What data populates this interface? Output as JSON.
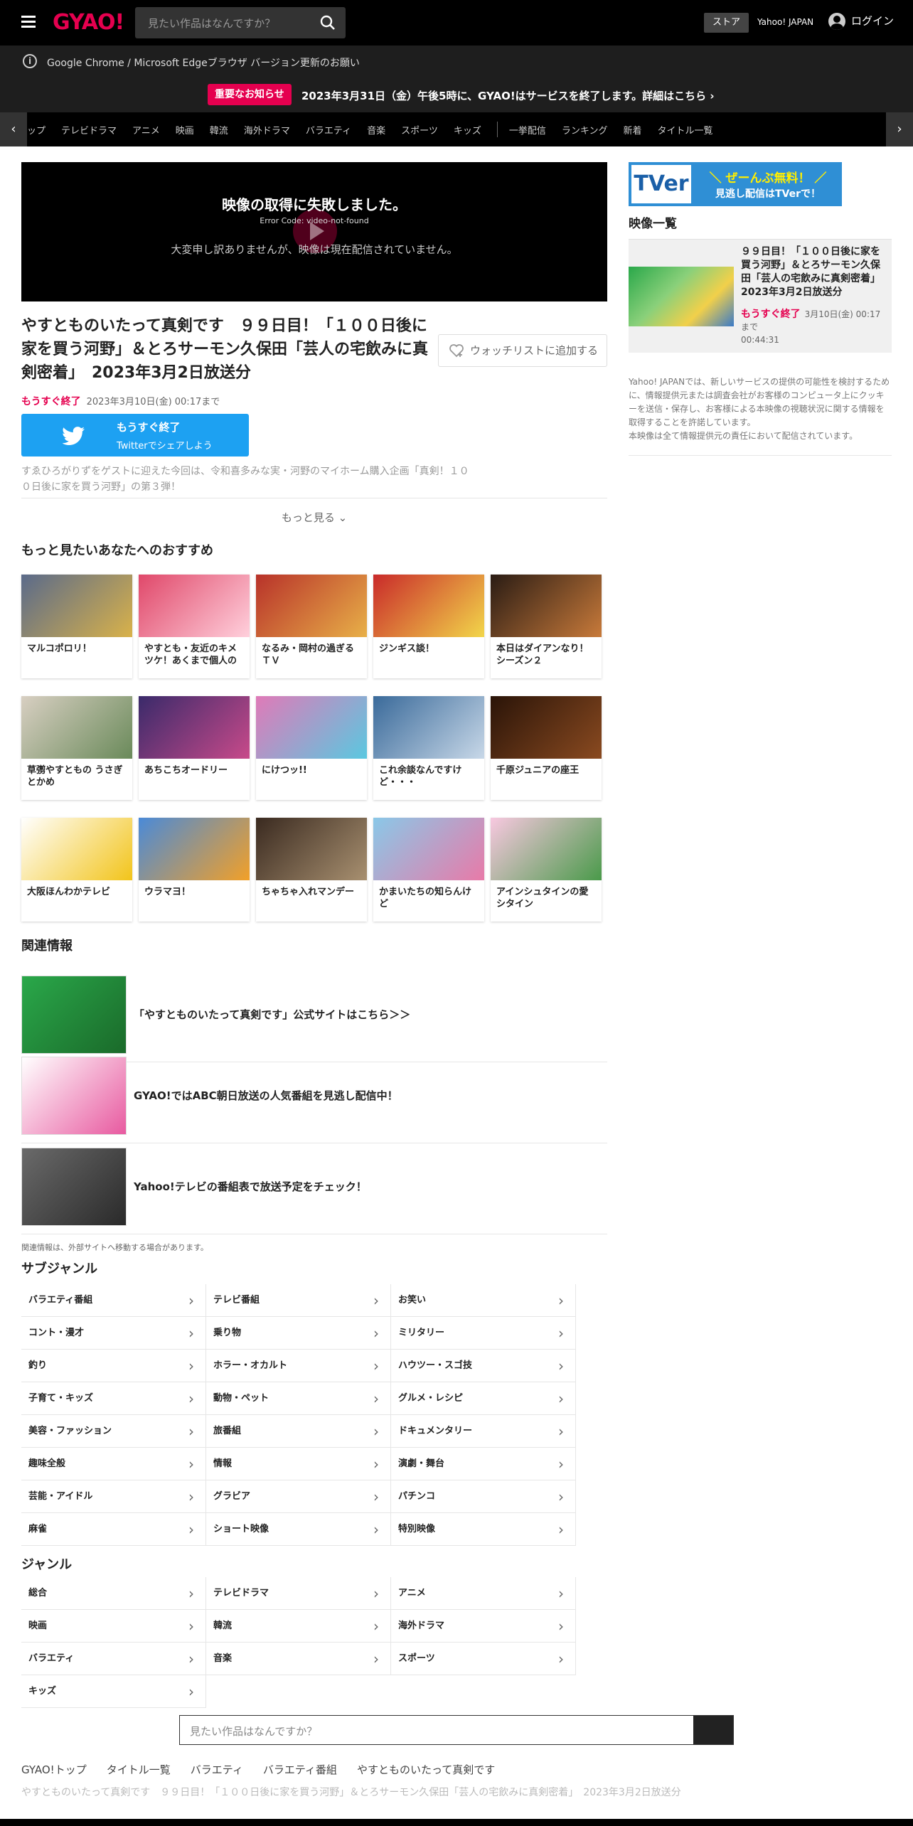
{
  "header": {
    "logo": "GYAO!",
    "search_placeholder": "見たい作品はなんですか？",
    "store": "ストア",
    "yahoo": "Yahoo! JAPAN",
    "login": "ログイン"
  },
  "notices": {
    "browser": "Google Chrome / Microsoft Edgeブラウザ バージョン更新のお願い",
    "badge": "重要なお知らせ",
    "end_service": "2023年3月31日（金）午後5時に、GYAO!はサービスを終了します。詳細はこちら"
  },
  "nav": {
    "left_arrow": "‹",
    "right_arrow": "›",
    "items": [
      "ップ",
      "テレビドラマ",
      "アニメ",
      "映画",
      "韓流",
      "海外ドラマ",
      "バラエティ",
      "音楽",
      "スポーツ",
      "キッズ"
    ],
    "items2": [
      "一挙配信",
      "ランキング",
      "新着",
      "タイトル一覧"
    ]
  },
  "player": {
    "error_title": "映像の取得に失敗しました。",
    "error_code": "Error Code: video-not-found",
    "error_message": "大変申し訳ありませんが、映像は現在配信されていません。"
  },
  "episode": {
    "title": "やすとものいたって真剣です　９９日目！「１００日後に家を買う河野」＆とろサーモン久保田「芸人の宅飲みに真剣密着」　2023年3月2日放送分",
    "watchlist": "ウォッチリストに追加する",
    "ending_soon": "もうすぐ終了",
    "until": "2023年3月10日(金) 00:17まで",
    "twitter_l1": "もうすぐ終了",
    "twitter_l2": "Twitterでシェアしよう",
    "description": "すゑひろがりずをゲストに迎えた今回は、令和喜多みな実・河野のマイホーム購入企画「真剣！１００日後に家を買う河野」の第３弾！",
    "more": "もっと見る"
  },
  "recommend": {
    "heading": "もっと見たいあなたへのおすすめ",
    "items": [
      {
        "label": "マルコポロリ！",
        "c1": "#5a6a8a",
        "c2": "#d9b24a"
      },
      {
        "label": "やすとも・友近のキメツケ！あくまで個人の",
        "c1": "#e0486a",
        "c2": "#ffd0dc"
      },
      {
        "label": "なるみ・岡村の過ぎるＴＶ",
        "c1": "#b8322a",
        "c2": "#e8b048"
      },
      {
        "label": "ジンギス談！",
        "c1": "#c92a2a",
        "c2": "#f2d64a"
      },
      {
        "label": "本日はダイアンなり！シーズン２",
        "c1": "#2a1c14",
        "c2": "#c87a3a"
      },
      {
        "label": "草彅やすともの うさぎとかめ",
        "c1": "#d8cfc2",
        "c2": "#6a8a5a"
      },
      {
        "label": "あちこちオードリー",
        "c1": "#3a2a6a",
        "c2": "#c84a8a"
      },
      {
        "label": "にけつッ!!",
        "c1": "#e07ab8",
        "c2": "#5ac8e0"
      },
      {
        "label": "これ余談なんですけど・・・",
        "c1": "#3a6a9a",
        "c2": "#c8d8e8"
      },
      {
        "label": "千原ジュニアの座王",
        "c1": "#2a1408",
        "c2": "#8a4a20"
      },
      {
        "label": "大阪ほんわかテレビ",
        "c1": "#ffffff",
        "c2": "#f2c41a"
      },
      {
        "label": "ウラマヨ！",
        "c1": "#4a8ad8",
        "c2": "#f2a028"
      },
      {
        "label": "ちゃちゃ入れマンデー",
        "c1": "#3a2a20",
        "c2": "#a89070"
      },
      {
        "label": "かまいたちの知らんけど",
        "c1": "#8ac8e8",
        "c2": "#e87aa8"
      },
      {
        "label": "アインシュタインの愛シタイン",
        "c1": "#f8c8e0",
        "c2": "#4a9a4a"
      }
    ]
  },
  "related": {
    "heading": "関連情報",
    "items": [
      {
        "text": "「やすとものいたって真剣です」公式サイトはこちら＞＞",
        "c1": "#2aa84a",
        "c2": "#1a6a2a"
      },
      {
        "text": "GYAO!ではABC朝日放送の人気番組を見逃し配信中！",
        "c1": "#ffffff",
        "c2": "#e85aa0"
      },
      {
        "text": "Yahoo!テレビの番組表で放送予定をチェック！",
        "c1": "#6a6a6a",
        "c2": "#2a2a2a"
      }
    ],
    "note": "関連情報は、外部サイトへ移動する場合があります。"
  },
  "subgenre": {
    "heading": "サブジャンル",
    "items": [
      "バラエティ番組",
      "テレビ番組",
      "お笑い",
      "コント・漫才",
      "乗り物",
      "ミリタリー",
      "釣り",
      "ホラー・オカルト",
      "ハウツー・スゴ技",
      "子育て・キッズ",
      "動物・ペット",
      "グルメ・レシピ",
      "美容・ファッション",
      "旅番組",
      "ドキュメンタリー",
      "趣味全般",
      "情報",
      "演劇・舞台",
      "芸能・アイドル",
      "グラビア",
      "パチンコ",
      "麻雀",
      "ショート映像",
      "特別映像"
    ]
  },
  "genre": {
    "heading": "ジャンル",
    "items": [
      "総合",
      "テレビドラマ",
      "アニメ",
      "映画",
      "韓流",
      "海外ドラマ",
      "バラエティ",
      "音楽",
      "スポーツ",
      "キッズ"
    ]
  },
  "bottom_search": {
    "placeholder": "見たい作品はなんですか？"
  },
  "breadcrumb": {
    "items": [
      "GYAO!トップ",
      "タイトル一覧",
      "バラエティ",
      "バラエティ番組",
      "やすとものいたって真剣です"
    ],
    "current": "やすとものいたって真剣です　９９日目！「１００日後に家を買う河野」＆とろサーモン久保田「芸人の宅飲みに真剣密着」　2023年3月2日放送分"
  },
  "side": {
    "tver_logo": "TVer",
    "tver_l1": "＼ ぜーんぶ無料！ ／",
    "tver_l2": "見逃し配信はTVerで！",
    "video_list": "映像一覧",
    "video_title": "９９日目！「１００日後に家を買う河野」＆とろサーモン久保田「芸人の宅飲みに真剣密着」2023年3月2日放送分",
    "video_status": "もうすぐ終了",
    "video_until": "3月10日(金) 00:17まで",
    "video_duration": "00:44:31",
    "note1": "Yahoo! JAPANでは、新しいサービスの提供の可能性を検討するために、情報提供元または調査会社がお客様のコンピュータ上にクッキーを送信・保存し、お客様による本映像の視聴状況に関する情報を取得することを許諾しています。",
    "note2": "本映像は全て情報提供元の責任において配信されています。"
  },
  "colors": {
    "brand": "#e5004f",
    "twitter": "#1da1f2",
    "tver": "#2f8fd5"
  }
}
